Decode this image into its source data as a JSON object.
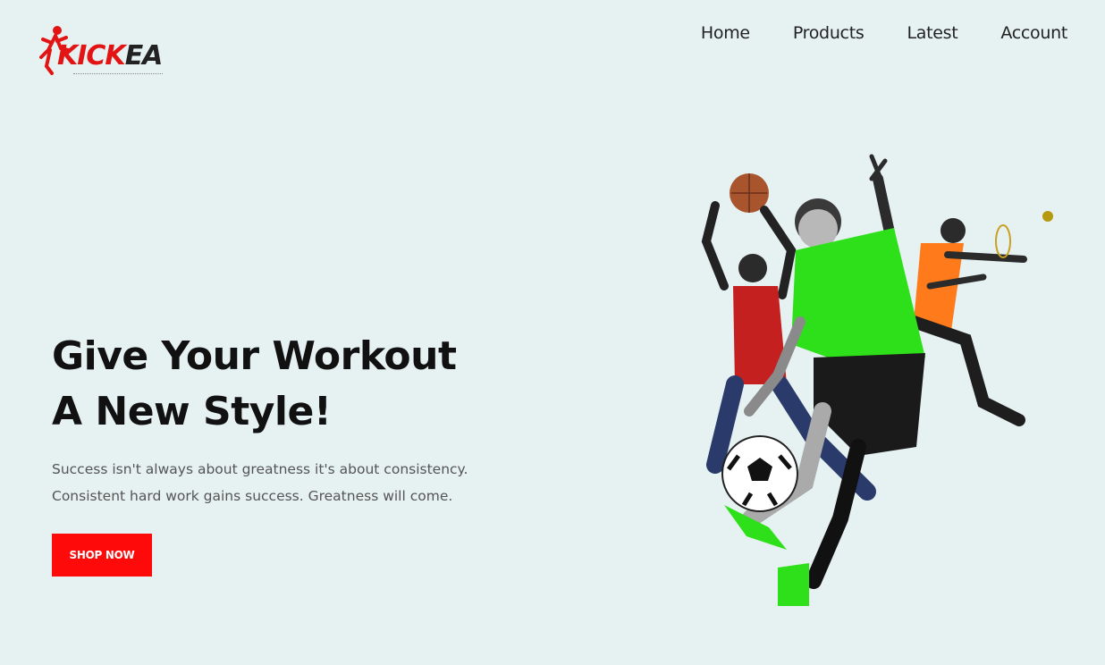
{
  "brand": {
    "name_part1": "KICK",
    "name_part2": "EA"
  },
  "nav": {
    "items": [
      {
        "label": "Home"
      },
      {
        "label": "Products"
      },
      {
        "label": "Latest"
      },
      {
        "label": "Account"
      }
    ]
  },
  "hero": {
    "title_line1": "Give Your Workout",
    "title_line2": "A New Style!",
    "text_line1": "Success isn't always about greatness it's about consistency.",
    "text_line2": "Consistent hard work gains success. Greatness will come.",
    "cta_label": "SHOP NOW"
  },
  "colors": {
    "background": "#e6f1f2",
    "accent": "#ff0a0a",
    "jersey_green": "#2ee01a",
    "jersey_orange": "#ff7a1a",
    "jersey_red": "#c42020"
  }
}
